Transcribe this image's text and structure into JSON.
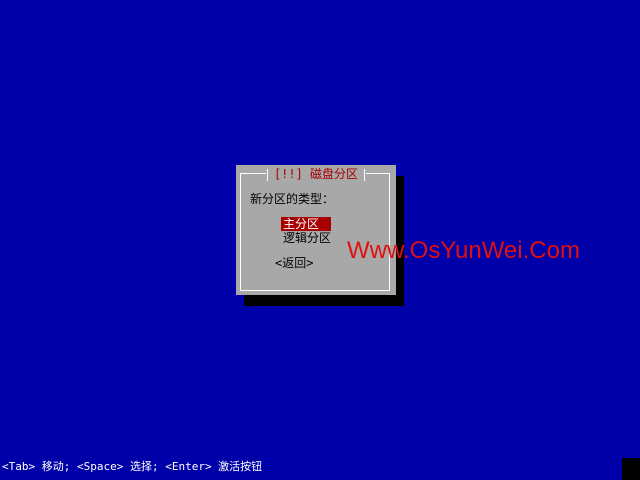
{
  "colors": {
    "background": "#0000a8",
    "dialog": "#a8a8a8",
    "accent": "#a80000",
    "watermark": "#e01010"
  },
  "dialog": {
    "title": "[!!] 磁盘分区",
    "prompt": "新分区的类型：",
    "options": [
      {
        "label": "主分区",
        "selected": true
      },
      {
        "label": "逻辑分区",
        "selected": false
      }
    ],
    "back_label": "<返回>"
  },
  "watermark": "Www.OsYunWei.Com",
  "status_bar": {
    "text": "<Tab> 移动; <Space> 选择; <Enter> 激活按钮"
  }
}
